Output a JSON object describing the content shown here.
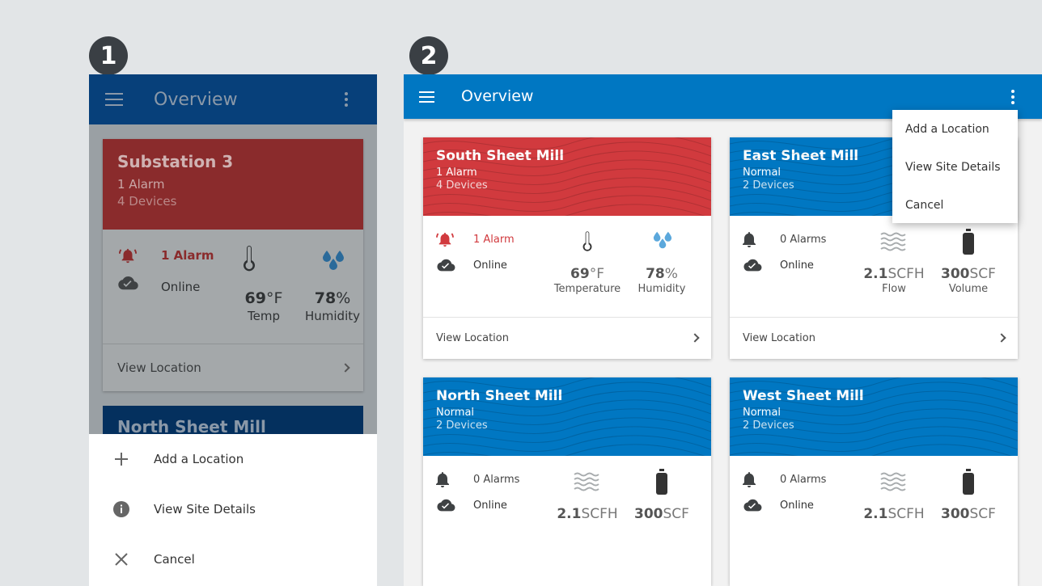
{
  "badges": {
    "one": "1",
    "two": "2"
  },
  "phone": {
    "title": "Overview",
    "card1": {
      "name": "Substation 3",
      "status": "1 Alarm",
      "devices": "4 Devices",
      "alarm": "1 Alarm",
      "online": "Online",
      "temp_value": "69",
      "temp_unit": "°F",
      "temp_label": "Temp",
      "humidity_value": "78",
      "humidity_unit": "%",
      "humidity_label": "Humidity",
      "view": "View Location"
    },
    "card2": {
      "name": "North Sheet Mill"
    },
    "sheet": {
      "add": "Add a Location",
      "details": "View Site Details",
      "cancel": "Cancel"
    }
  },
  "tablet": {
    "title": "Overview",
    "menu": {
      "add": "Add a Location",
      "details": "View Site Details",
      "cancel": "Cancel"
    },
    "cards": [
      {
        "name": "South Sheet Mill",
        "status": "1 Alarm",
        "devices": "4 Devices",
        "alarm": "1 Alarm",
        "online": "Online",
        "m1_value": "69",
        "m1_unit": "°F",
        "m1_label": "Temperature",
        "m2_value": "78",
        "m2_unit": "%",
        "m2_label": "Humidity",
        "view": "View Location"
      },
      {
        "name": "East Sheet Mill",
        "status": "Normal",
        "devices": "2 Devices",
        "alarm": "0 Alarms",
        "online": "Online",
        "m1_value": "2.1",
        "m1_unit": "SCFH",
        "m1_label": "Flow",
        "m2_value": "300",
        "m2_unit": "SCF",
        "m2_label": "Volume",
        "view": "View Location"
      },
      {
        "name": "North Sheet Mill",
        "status": "Normal",
        "devices": "2 Devices",
        "alarm": "0 Alarms",
        "online": "Online",
        "m1_value": "2.1",
        "m1_unit": "SCFH",
        "m2_value": "300",
        "m2_unit": "SCF"
      },
      {
        "name": "West Sheet Mill",
        "status": "Normal",
        "devices": "2 Devices",
        "alarm": "0 Alarms",
        "online": "Online",
        "m1_value": "2.1",
        "m1_unit": "SCFH",
        "m2_value": "300",
        "m2_unit": "SCF"
      }
    ]
  },
  "colors": {
    "alarm_red": "#d13a3e",
    "primary_blue": "#0077c2",
    "badge": "#3a3f44"
  }
}
